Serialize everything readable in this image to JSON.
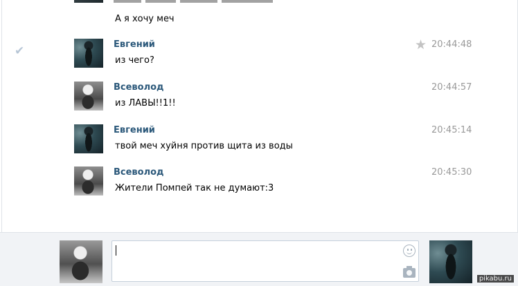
{
  "conversation": {
    "continued_text": "А я хочу меч",
    "messages": [
      {
        "author": "Евгений",
        "text": "из чего?",
        "time": "20:44:48",
        "starred": true,
        "read_mark": true
      },
      {
        "author": "Всеволод",
        "text": "из ЛАВЫ!!1!!",
        "time": "20:44:57"
      },
      {
        "author": "Евгений",
        "text": "твой меч хуйня против щита из воды",
        "time": "20:45:14"
      },
      {
        "author": "Всеволод",
        "text": "Жители Помпей так не думают:3",
        "time": "20:45:30"
      }
    ]
  },
  "composer": {
    "value": "",
    "placeholder": ""
  },
  "icons": {
    "check": "check-icon",
    "star": "star-icon",
    "smile": "smile-icon",
    "camera": "camera-icon"
  },
  "colors": {
    "author_name": "#2b587a",
    "timestamp": "#999999",
    "composer_bg": "#f1f3f6"
  },
  "watermark": "pikabu.ru"
}
